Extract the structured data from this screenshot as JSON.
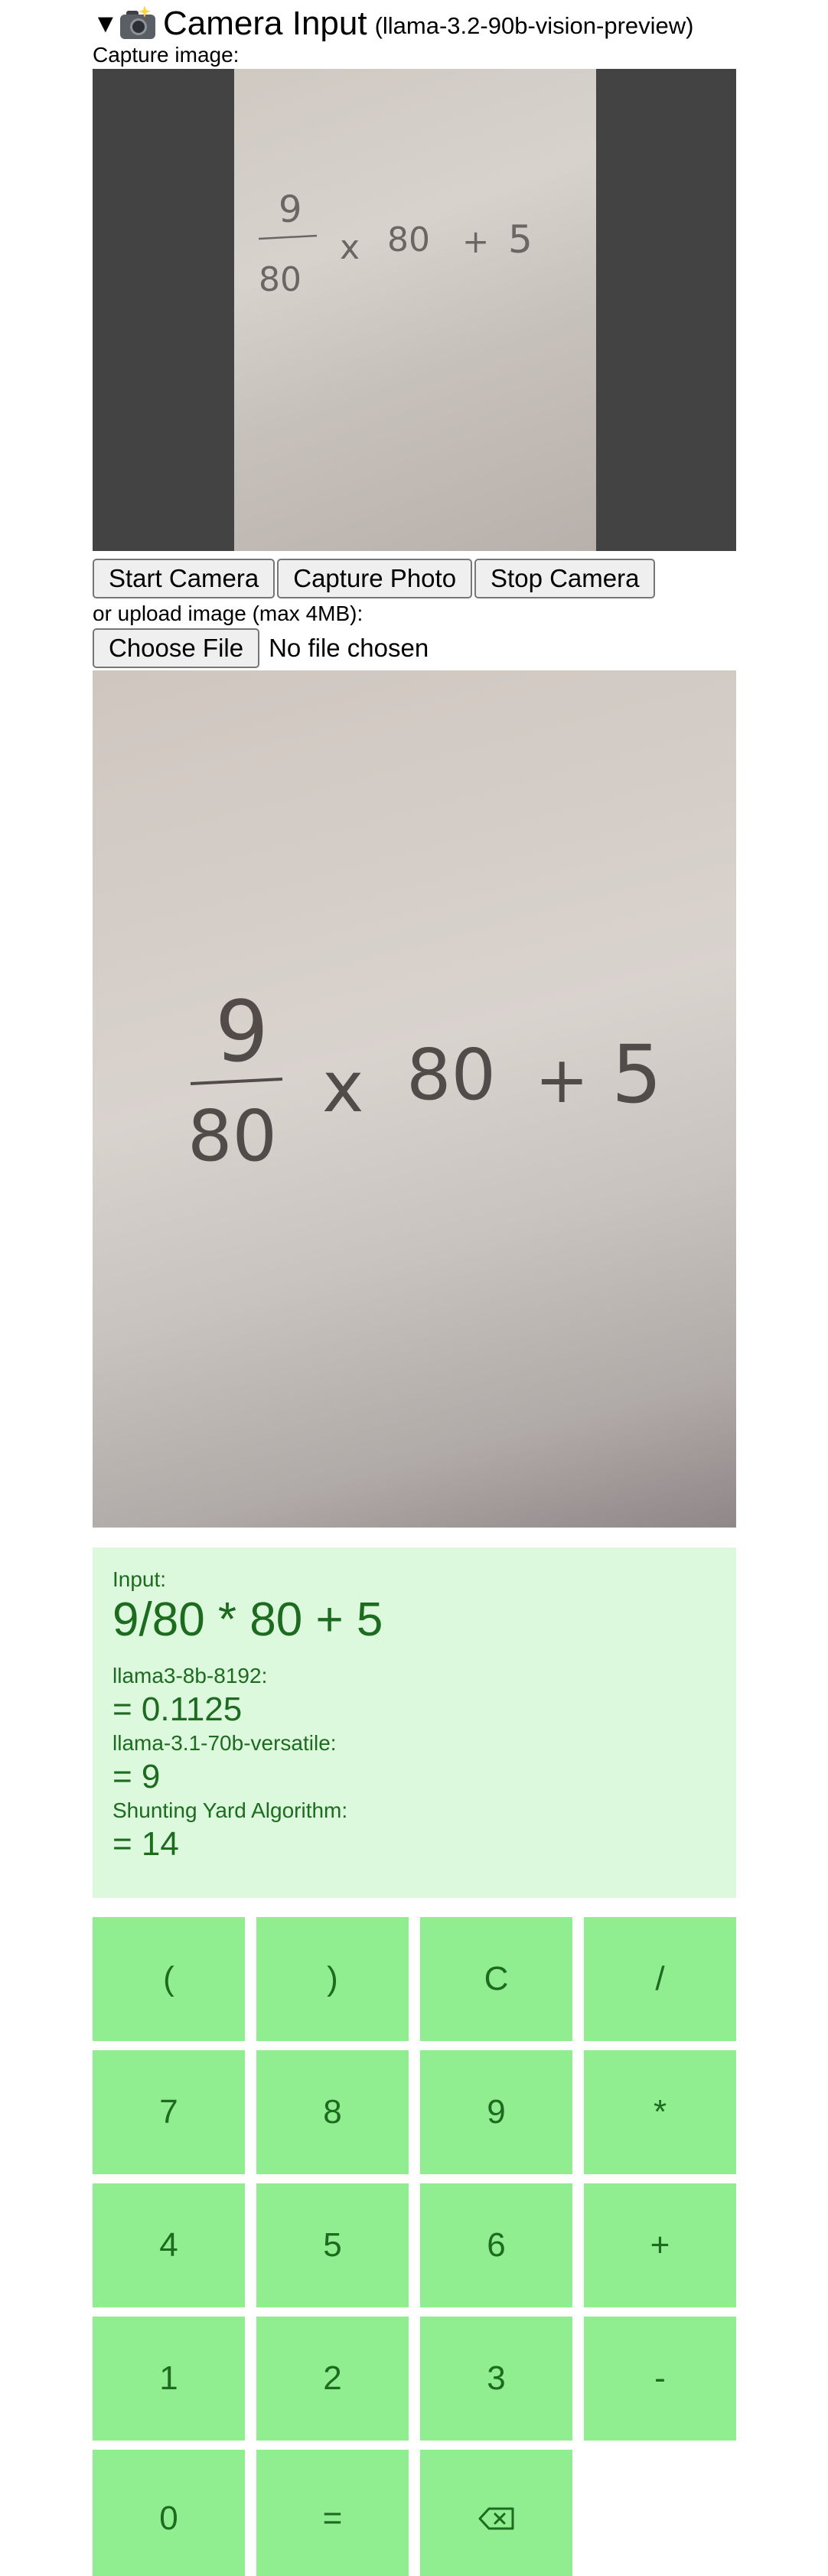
{
  "camera": {
    "toggle_glyph": "▼",
    "title": "Camera Input",
    "model": "(llama-3.2-90b-vision-preview)",
    "capture_label": "Capture image:",
    "buttons": {
      "start": "Start Camera",
      "capture": "Capture Photo",
      "stop": "Stop Camera"
    },
    "upload_label": "or upload image (max 4MB):",
    "file_button": "Choose File",
    "file_status": "No file chosen",
    "handwriting": {
      "numerator": "9",
      "denominator": "80",
      "times": "x",
      "factor": "80",
      "plus": "+",
      "addend": "5"
    }
  },
  "results": {
    "input_label": "Input:",
    "input_value": "9/80 * 80 + 5",
    "model1_label": "llama3-8b-8192:",
    "model1_value": "= 0.1125",
    "model2_label": "llama-3.1-70b-versatile:",
    "model2_value": "= 9",
    "algo_label": "Shunting Yard Algorithm:",
    "algo_value": "= 14"
  },
  "keypad": {
    "keys": [
      "(",
      ")",
      "C",
      "/",
      "7",
      "8",
      "9",
      "*",
      "4",
      "5",
      "6",
      "+",
      "1",
      "2",
      "3",
      "-",
      "0",
      "="
    ],
    "backspace_icon": "backspace-icon"
  },
  "colors": {
    "key_bg": "#90ee90",
    "key_text": "#1d6b1f",
    "result_bg": "#dcf8dd",
    "video_bg": "#434343"
  }
}
